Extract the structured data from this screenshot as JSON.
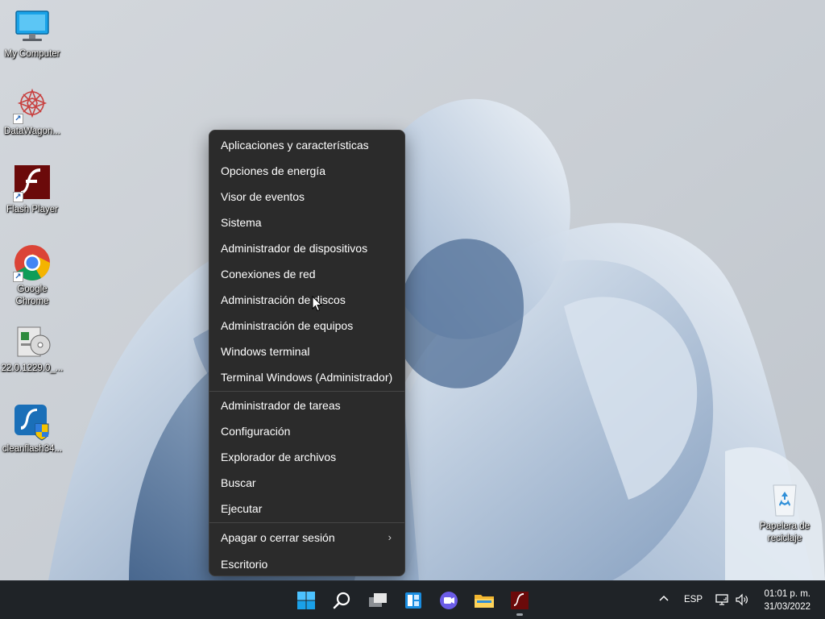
{
  "desktop": {
    "icons": [
      {
        "label": "My Computer",
        "icon": "monitor-icon"
      },
      {
        "label": "DataWagon...",
        "icon": "datawagon-icon"
      },
      {
        "label": "Flash Player",
        "icon": "flash-icon"
      },
      {
        "label": "Google Chrome",
        "icon": "chrome-icon"
      },
      {
        "label": "22.0.1229.0_...",
        "icon": "installer-icon"
      },
      {
        "label": "cleanflash34...",
        "icon": "cleanflash-icon"
      },
      {
        "label": "Papelera de reciclaje",
        "icon": "recycle-bin-icon"
      }
    ]
  },
  "context_menu": {
    "group1": [
      "Aplicaciones y características",
      "Opciones de energía",
      "Visor de eventos",
      "Sistema",
      "Administrador de dispositivos",
      "Conexiones de red",
      "Administración de discos",
      "Administración de equipos",
      "Windows terminal",
      "Terminal Windows (Administrador)"
    ],
    "group2": [
      "Administrador de tareas",
      "Configuración",
      "Explorador de archivos",
      "Buscar",
      "Ejecutar"
    ],
    "group3": [
      "Apagar o cerrar sesión",
      "Escritorio"
    ],
    "submenu_arrow": "›"
  },
  "taskbar": {
    "apps": [
      "start-icon",
      "search-icon",
      "task-view-icon",
      "widgets-icon",
      "chat-icon",
      "file-explorer-icon",
      "flash-player-icon"
    ],
    "tray": {
      "overflow": "^",
      "language": "ESP",
      "time": "01:01 p. m.",
      "date": "31/03/2022"
    }
  },
  "colors": {
    "menu_bg": "#2b2b2b",
    "taskbar_bg": "#1f2327",
    "accent": "#0078d4"
  }
}
